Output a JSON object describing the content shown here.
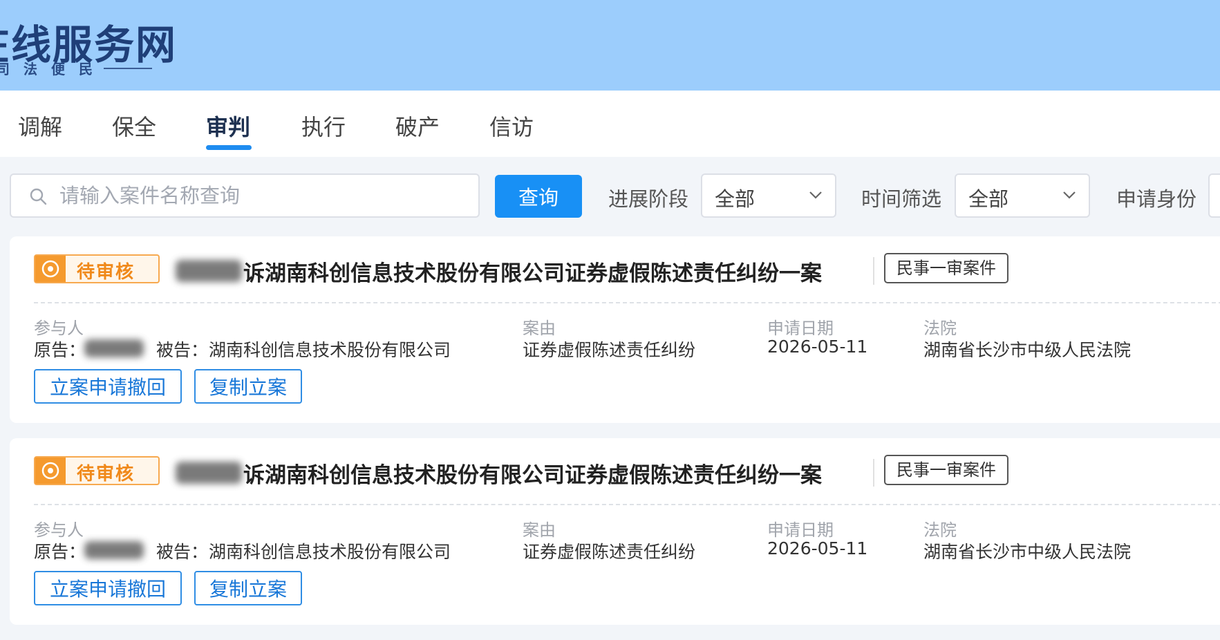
{
  "header": {
    "site_title": "在线服务网",
    "slogan": "司法便民"
  },
  "tabs": [
    {
      "label": "调解",
      "active": false
    },
    {
      "label": "保全",
      "active": false
    },
    {
      "label": "审判",
      "active": true
    },
    {
      "label": "执行",
      "active": false
    },
    {
      "label": "破产",
      "active": false
    },
    {
      "label": "信访",
      "active": false
    }
  ],
  "filters": {
    "search_placeholder": "请输入案件名称查询",
    "search_value": "",
    "query_label": "查询",
    "stage_label": "进展阶段",
    "stage_value": "全部",
    "time_label": "时间筛选",
    "time_value": "全部",
    "identity_label": "申请身份"
  },
  "field_labels": {
    "participants": "参与人",
    "cause": "案由",
    "apply_date": "申请日期",
    "court": "法院"
  },
  "cases": [
    {
      "status": "待审核",
      "title_suffix": "诉湖南科创信息技术股份有限公司证券虚假陈述责任纠纷一案",
      "case_type": "民事一审案件",
      "plaintiff_label": "原告：",
      "defendant_label": "被告：",
      "defendant": "湖南科创信息技术股份有限公司",
      "cause": "证券虚假陈述责任纠纷",
      "apply_date": "2026-05-11",
      "court": "湖南省长沙市中级人民法院",
      "btn_withdraw": "立案申请撤回",
      "btn_copy": "复制立案"
    },
    {
      "status": "待审核",
      "title_suffix": "诉湖南科创信息技术股份有限公司证券虚假陈述责任纠纷一案",
      "case_type": "民事一审案件",
      "plaintiff_label": "原告：",
      "defendant_label": "被告：",
      "defendant": "湖南科创信息技术股份有限公司",
      "cause": "证券虚假陈述责任纠纷",
      "apply_date": "2026-05-11",
      "court": "湖南省长沙市中级人民法院",
      "btn_withdraw": "立案申请撤回",
      "btn_copy": "复制立案"
    }
  ]
}
